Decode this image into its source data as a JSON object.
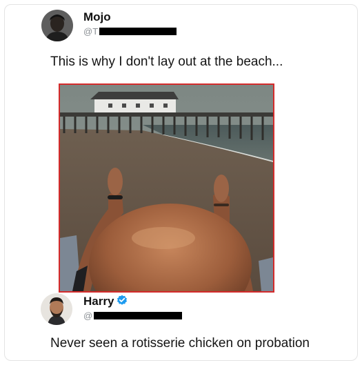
{
  "tweet": {
    "author": "Mojo",
    "handle_prefix": "@T",
    "text": "This is why I don't lay out at the beach..."
  },
  "reply": {
    "author": "Harry",
    "handle_prefix": "@",
    "verified": true,
    "text": "Never seen a rotisserie chicken on probation"
  },
  "colors": {
    "photo_border": "#d42a2a",
    "verified_badge": "#1d9bf0"
  },
  "icons": [
    "verified-badge-icon"
  ]
}
